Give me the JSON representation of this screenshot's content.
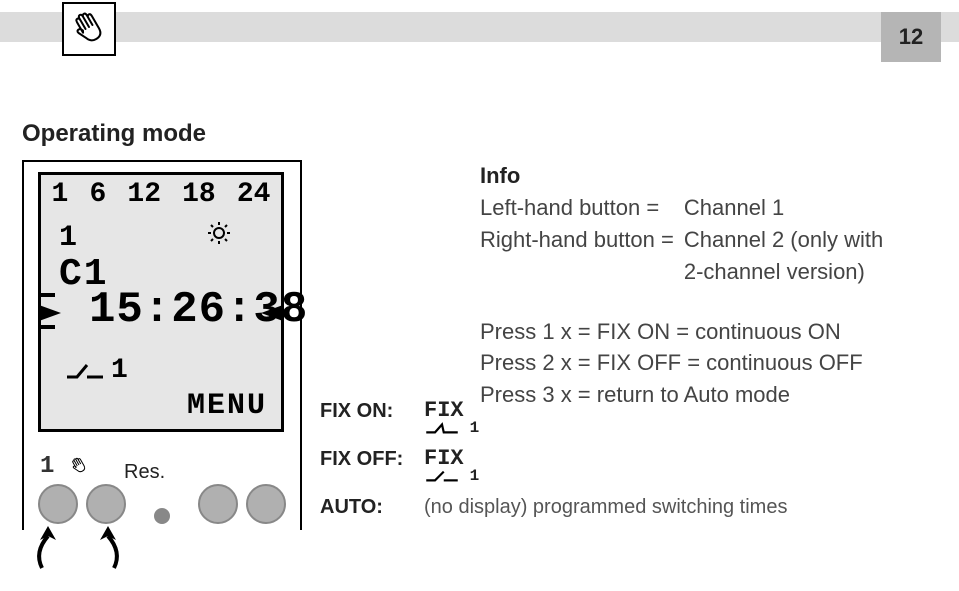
{
  "page_number": "12",
  "heading": "Operating mode",
  "lcd": {
    "scale": [
      "1",
      "6",
      "12",
      "18",
      "24"
    ],
    "top_indicator": "1",
    "channel": "C1",
    "time": "15:26:38",
    "relay_channel": "1",
    "menu": "MENU"
  },
  "device": {
    "button1_label": "1",
    "reset_label": "Res."
  },
  "info": {
    "title": "Info",
    "left_label": "Left-hand button =",
    "left_value": "Channel 1",
    "right_label": "Right-hand button =",
    "right_value_1": "Channel 2 (only with",
    "right_value_2": "2-channel version)",
    "press1": "Press 1 x = FIX ON = continuous ON",
    "press2": "Press 2 x = FIX OFF = continuous OFF",
    "press3": "Press 3 x = return to Auto mode"
  },
  "legend": {
    "fix_on_label": "FIX ON:",
    "fix_on_sym": "FIX",
    "fix_on_sub": "1",
    "fix_off_label": "FIX OFF:",
    "fix_off_sym": "FIX",
    "fix_off_sub": "1",
    "auto_label": "AUTO:",
    "auto_note": "(no display) programmed switching times"
  }
}
